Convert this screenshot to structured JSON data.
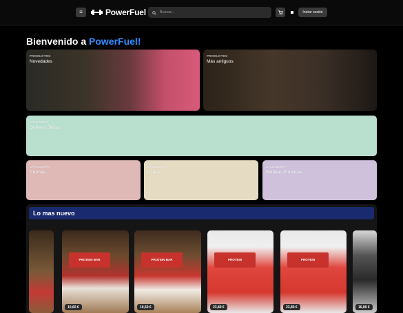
{
  "header": {
    "menu_icon": "hamburger-icon",
    "brand": "PowerFuel",
    "search_placeholder": "Buscar...",
    "cart_icon": "cart-icon",
    "login_label": "Iniciar sesión"
  },
  "welcome": {
    "prefix": "Bienvenido a ",
    "brand": "PowerFuel!"
  },
  "cards": {
    "novedades": {
      "kicker": "PRODUCTOS",
      "title": "Novedades"
    },
    "antiguos": {
      "kicker": "PRODUCTOS",
      "title": "Más antiguos"
    },
    "gofres": {
      "kicker": "CATEGORÍA",
      "title": "Gofres y Tartas"
    },
    "cremas": {
      "kicker": "CATEGORÍA",
      "title": "Cremas"
    },
    "platos": {
      "kicker": "CATEGORÍA",
      "title": "Platos"
    },
    "bebidas": {
      "kicker": "CATEGORÍA",
      "title": "Bebidas Proteicas"
    }
  },
  "newest": {
    "title": "Lo mas nuevo",
    "products": [
      {
        "price": ""
      },
      {
        "price": "10,60 €",
        "box": "PROTEIN BAR"
      },
      {
        "price": "10,60 €",
        "box": "PROTEIN BAR"
      },
      {
        "price": "23,80 €",
        "box": "PROTEIN"
      },
      {
        "price": "23,80 €",
        "box": "PROTEIN"
      },
      {
        "price": "16,80 €"
      }
    ]
  },
  "colors": {
    "brand_blue": "#2f8cff",
    "section_header": "#1a2a6e",
    "gofres": "#b9dfcf",
    "cremas": "#dfb9b5",
    "platos": "#e5dac2",
    "bebidas": "#cfc1dc"
  }
}
